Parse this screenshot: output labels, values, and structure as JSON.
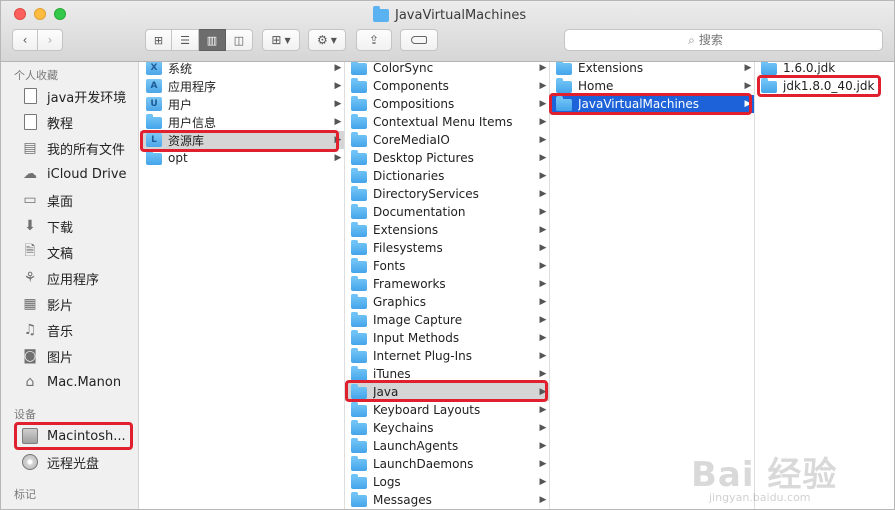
{
  "window": {
    "title": "JavaVirtualMachines"
  },
  "toolbar": {
    "back_glyph": "‹",
    "forward_glyph": "›",
    "view_icons": [
      "grid-icon",
      "list-icon",
      "column-icon",
      "coverflow-icon"
    ],
    "search_placeholder": "搜索"
  },
  "sidebar": {
    "sections": [
      {
        "label": "个人收藏"
      },
      {
        "label": "设备"
      },
      {
        "label": "标记"
      }
    ],
    "favorites": [
      {
        "label": "java开发环境",
        "icon": "document-icon"
      },
      {
        "label": "教程",
        "icon": "document-icon"
      },
      {
        "label": "我的所有文件",
        "icon": "all-files-icon"
      },
      {
        "label": "iCloud Drive",
        "icon": "cloud-icon"
      },
      {
        "label": "桌面",
        "icon": "desktop-icon"
      },
      {
        "label": "下载",
        "icon": "download-icon"
      },
      {
        "label": "文稿",
        "icon": "documents-icon"
      },
      {
        "label": "应用程序",
        "icon": "applications-icon"
      },
      {
        "label": "影片",
        "icon": "movies-icon"
      },
      {
        "label": "音乐",
        "icon": "music-icon"
      },
      {
        "label": "图片",
        "icon": "pictures-icon"
      },
      {
        "label": "Mac.Manon",
        "icon": "home-icon"
      }
    ],
    "devices": [
      {
        "label": "Macintosh...",
        "icon": "hard-drive-icon"
      },
      {
        "label": "远程光盘",
        "icon": "remote-disc-icon"
      }
    ]
  },
  "columns": {
    "col1": [
      {
        "label": "系统",
        "glyph": "X"
      },
      {
        "label": "应用程序",
        "glyph": "A"
      },
      {
        "label": "用户",
        "glyph": "U"
      },
      {
        "label": "用户信息",
        "glyph": ""
      },
      {
        "label": "资源库",
        "glyph": "L"
      },
      {
        "label": "opt",
        "glyph": ""
      }
    ],
    "col2": [
      "ColorSync",
      "Components",
      "Compositions",
      "Contextual Menu Items",
      "CoreMediaIO",
      "Desktop Pictures",
      "Dictionaries",
      "DirectoryServices",
      "Documentation",
      "Extensions",
      "Filesystems",
      "Fonts",
      "Frameworks",
      "Graphics",
      "Image Capture",
      "Input Methods",
      "Internet Plug-Ins",
      "iTunes",
      "Java",
      "Keyboard Layouts",
      "Keychains",
      "LaunchAgents",
      "LaunchDaemons",
      "Logs",
      "Messages"
    ],
    "col3": [
      "Extensions",
      "Home",
      "JavaVirtualMachines"
    ],
    "col4": [
      "1.6.0.jdk",
      "jdk1.8.0_40.jdk"
    ]
  },
  "watermark": {
    "text": "Bai 经验",
    "url": "jingyan.baidu.com"
  }
}
